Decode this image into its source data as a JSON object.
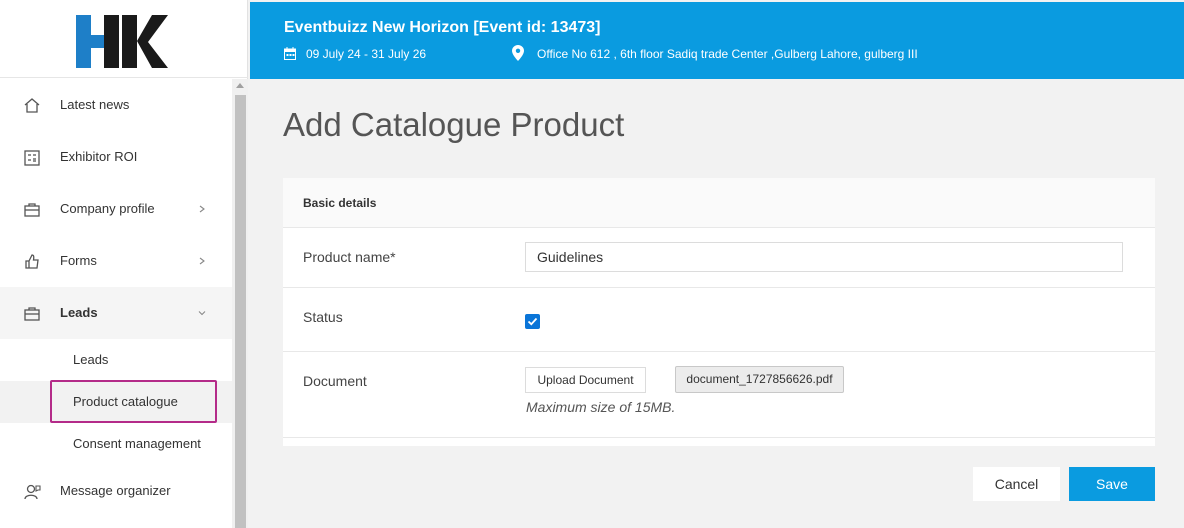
{
  "logo": {
    "text": "HK"
  },
  "header": {
    "title": "Eventbuizz New Horizon [Event id: 13473]",
    "date": "09 July 24 - 31 July 26",
    "location": "Office No 612 , 6th floor Sadiq trade Center ,Gulberg Lahore, gulberg III"
  },
  "sidebar": {
    "items": [
      {
        "label": "Latest news",
        "icon": "home-icon"
      },
      {
        "label": "Exhibitor ROI",
        "icon": "calculator-icon"
      },
      {
        "label": "Company profile",
        "icon": "briefcase-icon"
      },
      {
        "label": "Forms",
        "icon": "thumbs-up-icon"
      },
      {
        "label": "Leads",
        "icon": "briefcase-icon"
      }
    ],
    "sub_items": [
      {
        "label": "Leads"
      },
      {
        "label": "Product catalogue"
      },
      {
        "label": "Consent management"
      }
    ],
    "bottom_item": {
      "label": "Message organizer",
      "icon": "user-chat-icon"
    }
  },
  "main": {
    "page_title": "Add Catalogue Product",
    "section_title": "Basic details",
    "fields": {
      "product_name_label": "Product name*",
      "product_name_value": "Guidelines",
      "status_label": "Status",
      "status_checked": true,
      "document_label": "Document",
      "upload_button": "Upload Document",
      "file_name": "document_1727856626.pdf",
      "max_size_hint": "Maximum size of 15MB."
    },
    "cancel_label": "Cancel",
    "save_label": "Save"
  },
  "colors": {
    "accent": "#0a9be0",
    "highlight": "#b42b89",
    "checkbox": "#0a75d8"
  }
}
